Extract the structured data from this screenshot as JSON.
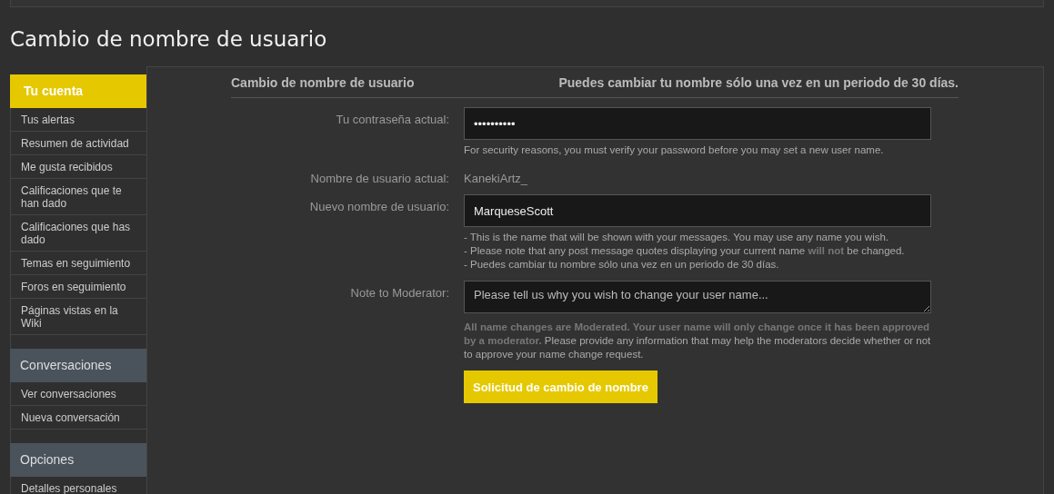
{
  "page_title": "Cambio de nombre de usuario",
  "sidebar": [
    {
      "heading": "Tu cuenta",
      "selected": true,
      "items": [
        "Tus alertas",
        "Resumen de actividad",
        "Me gusta recibidos",
        "Calificaciones que te han dado",
        "Calificaciones que has dado",
        "Temas en seguimiento",
        "Foros en seguimiento",
        "Páginas vistas en la Wiki"
      ]
    },
    {
      "heading": "Conversaciones",
      "selected": false,
      "items": [
        "Ver conversaciones",
        "Nueva conversación"
      ]
    },
    {
      "heading": "Opciones",
      "selected": false,
      "items": [
        "Detalles personales"
      ]
    }
  ],
  "form": {
    "title": "Cambio de nombre de usuario",
    "notice": "Puedes cambiar tu nombre sólo una vez en un periodo de 30 días.",
    "rows": [
      {
        "kind": "input",
        "label": "Tu contraseña actual:",
        "value": "••••••••••",
        "help": [
          "For security reasons, you must verify your password before you may set a new user name."
        ]
      },
      {
        "kind": "text",
        "label": "Nombre de usuario actual:",
        "value": "KanekiArtz_"
      },
      {
        "kind": "input",
        "label": "Nuevo nombre de usuario:",
        "value": "MarqueseScott",
        "help": [
          "- This is the name that will be shown with your messages. You may use any name you wish.",
          "- Please note that any post message quotes displaying your current name **will not** be changed.",
          "- Puedes cambiar tu nombre sólo una vez en un periodo de 30 días."
        ]
      },
      {
        "kind": "textarea",
        "label": "Note to Moderator:",
        "placeholder": "Please tell us why you wish to change your user name...",
        "help": [
          "**All name changes are Moderated. Your user name will only change once it has been approved by a moderator.** Please provide any information that may help the moderators decide whether or not to approve your name change request."
        ]
      }
    ],
    "submit": "Solicitud de cambio de nombre"
  }
}
